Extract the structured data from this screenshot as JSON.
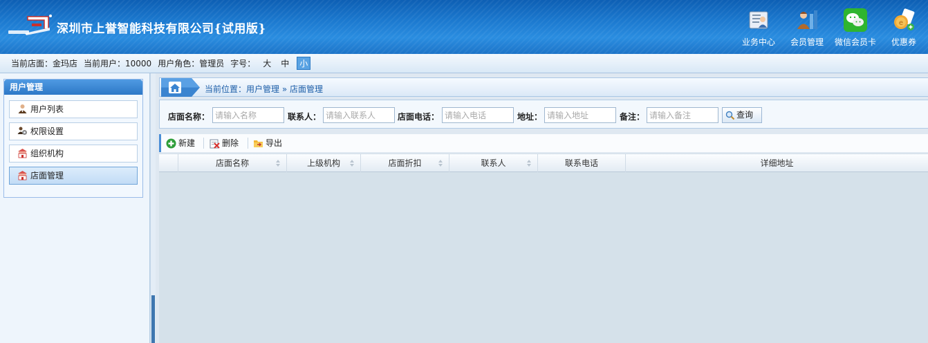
{
  "header": {
    "company_title": "深圳市上誉智能科技有限公司{试用版}",
    "nav": [
      {
        "label": "业务中心",
        "icon": "business-center-icon"
      },
      {
        "label": "会员管理",
        "icon": "member-management-icon"
      },
      {
        "label": "微信会员卡",
        "icon": "wechat-icon"
      },
      {
        "label": "优惠券",
        "icon": "coupon-icon"
      }
    ]
  },
  "status": {
    "store": "当前店面：金玛店",
    "user": "当前用户：10000",
    "role": "用户角色：管理员",
    "font_label": "字号：",
    "font_sizes": [
      "大",
      "中",
      "小"
    ],
    "active_font_size": "小"
  },
  "sidebar": {
    "title": "用户管理",
    "items": [
      {
        "label": "用户列表",
        "icon": "user-icon"
      },
      {
        "label": "权限设置",
        "icon": "permissions-icon"
      },
      {
        "label": "组织机构",
        "icon": "organization-icon"
      },
      {
        "label": "店面管理",
        "icon": "store-icon",
        "active": true
      }
    ]
  },
  "breadcrumb": {
    "text": "当前位置：用户管理 » 店面管理"
  },
  "search": {
    "fields": [
      {
        "label": "店面名称：",
        "placeholder": "请输入名称"
      },
      {
        "label": "联系人：",
        "placeholder": "请输入联系人"
      },
      {
        "label": "店面电话：",
        "placeholder": "请输入电话"
      },
      {
        "label": "地址：",
        "placeholder": "请输入地址"
      },
      {
        "label": "备注：",
        "placeholder": "请输入备注"
      }
    ],
    "query_label": "查询"
  },
  "toolbar": {
    "new_label": "新建",
    "delete_label": "删除",
    "export_label": "导出"
  },
  "grid": {
    "columns": [
      "店面名称",
      "上级机构",
      "店面折扣",
      "联系人",
      "联系电话",
      "详细地址"
    ],
    "rows": []
  },
  "colors": {
    "header_blue": "#1c7ad0",
    "accent_blue": "#2d78c7",
    "grid_bg": "#d5e1ea"
  }
}
